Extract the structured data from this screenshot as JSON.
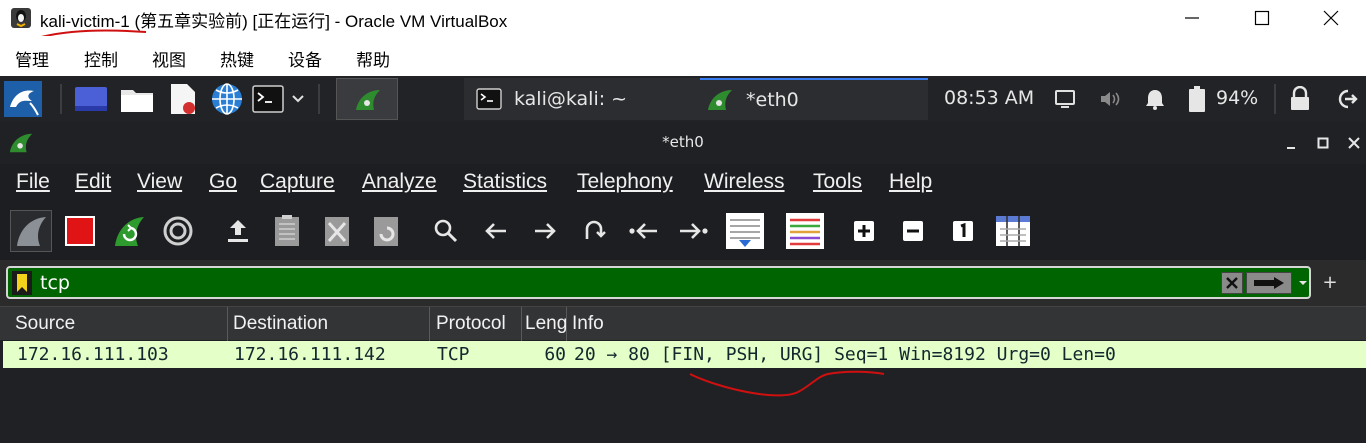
{
  "vbox": {
    "title": "kali-victim-1 (第五章实验前) [正在运行] - Oracle VM VirtualBox",
    "menu": [
      "管理",
      "控制",
      "视图",
      "热键",
      "设备",
      "帮助"
    ]
  },
  "panel": {
    "tasks": {
      "terminal": "kali@kali: ~",
      "wireshark": "*eth0"
    },
    "clock": "08:53 AM",
    "battery": "94%"
  },
  "wireshark": {
    "title": "*eth0",
    "menu": {
      "file": "File",
      "edit": "Edit",
      "view": "View",
      "go": "Go",
      "capture": "Capture",
      "analyze": "Analyze",
      "statistics": "Statistics",
      "telephony": "Telephony",
      "wireless": "Wireless",
      "tools": "Tools",
      "help": "Help"
    },
    "filter": {
      "value": "tcp"
    },
    "columns": {
      "source": "Source",
      "destination": "Destination",
      "protocol": "Protocol",
      "length": "Leng",
      "info": "Info"
    },
    "packets": [
      {
        "source": "172.16.111.103",
        "destination": "172.16.111.142",
        "protocol": "TCP",
        "length": "60",
        "info": "20 → 80 [FIN, PSH, URG] Seq=1 Win=8192 Urg=0 Len=0"
      }
    ]
  },
  "colors": {
    "filter_valid": "#006400",
    "packet_row": "#e4ffc7",
    "annotation": "#d01010"
  }
}
